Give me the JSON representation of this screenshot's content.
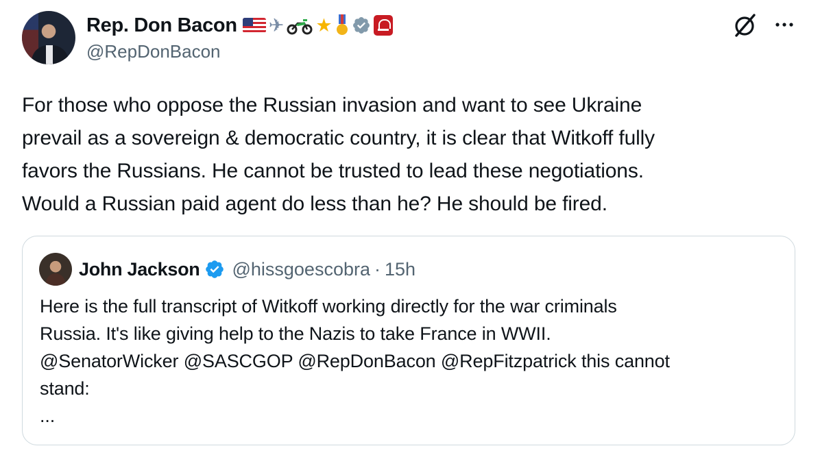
{
  "author": {
    "display_name": "Rep. Don Bacon",
    "handle": "@RepDonBacon",
    "emoji_badges": [
      "us-flag-emoji",
      "airplane-emoji",
      "motorcycle-emoji",
      "star-emoji",
      "military-medal-emoji",
      "government-verified-badge",
      "capitol-affiliate-badge"
    ]
  },
  "tweet": {
    "text_lines": [
      "For those who oppose the Russian invasion and want to see Ukraine",
      "prevail as a sovereign & democratic country, it is clear that Witkoff fully",
      "favors the Russians. He cannot be trusted to lead these negotiations.",
      "Would a Russian paid agent do less than he? He should be fired."
    ]
  },
  "quote": {
    "display_name": "John Jackson",
    "handle": "@hissgoescobra",
    "separator": "·",
    "time": "15h",
    "text_lines": [
      "Here is the full transcript of Witkoff working directly for the war criminals",
      "Russia.  It's like giving help to the Nazis to take France in WWII.",
      "@SenatorWicker @SASCGOP @RepDonBacon @RepFitzpatrick this cannot",
      "stand:",
      "..."
    ]
  },
  "colors": {
    "text": "#0f1419",
    "secondary": "#536471",
    "verified_blue": "#1d9bf0",
    "gov_gray": "#829aab",
    "border": "#cfd9de"
  },
  "icons": {
    "grok": "grok-icon",
    "more": "more-icon"
  }
}
